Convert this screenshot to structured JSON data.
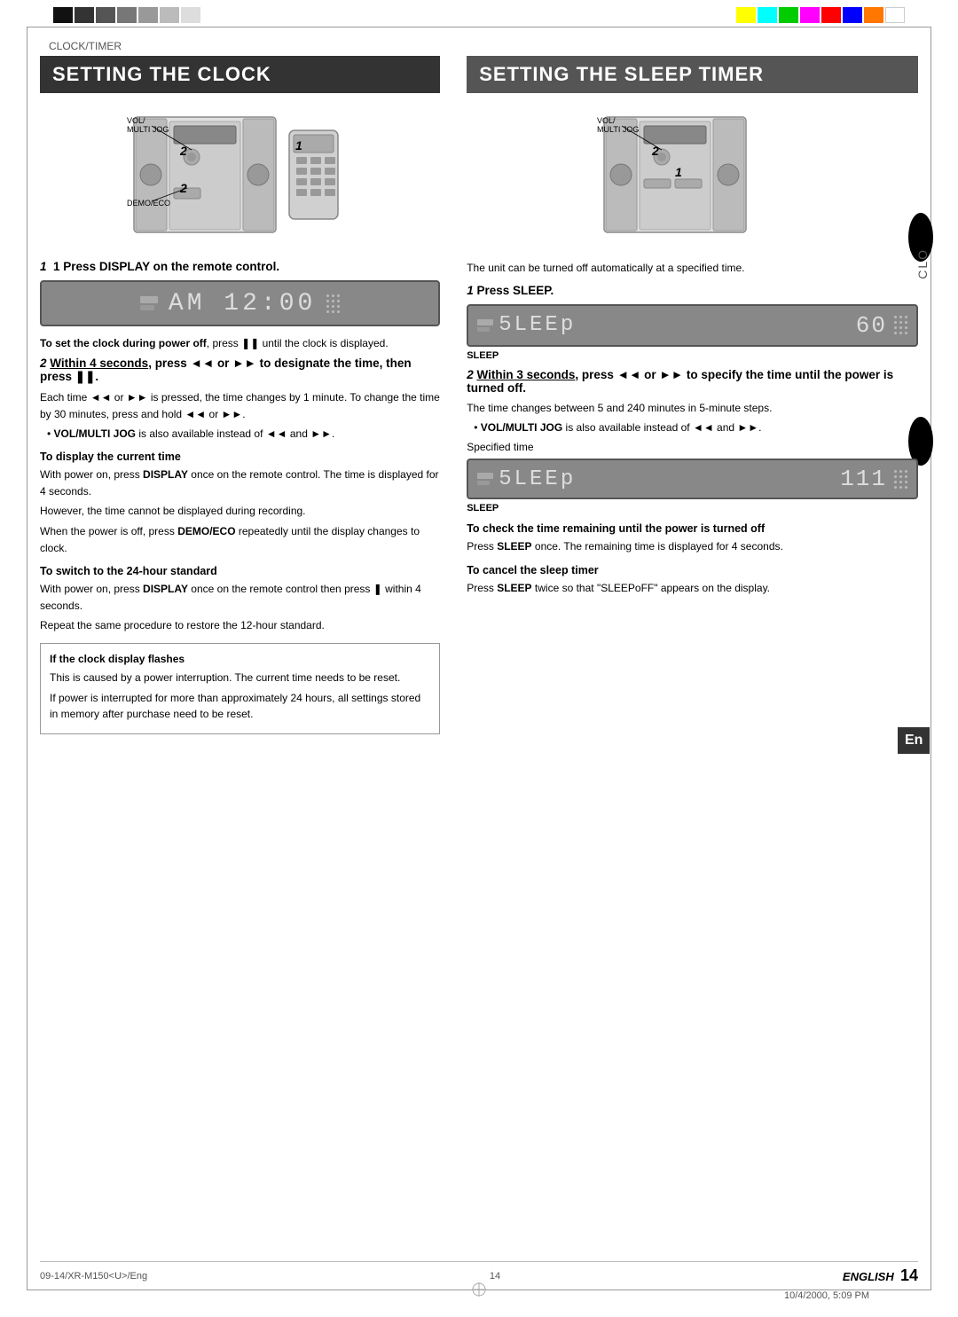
{
  "page": {
    "header_label": "CLOCK/TIMER",
    "footer_left": "09-14/XR-M150<U>/Eng",
    "footer_center": "14",
    "footer_right_label": "ENGLISH",
    "footer_page_num": "14",
    "footer_date": "10/4/2000, 5:09 PM",
    "en_badge": "En",
    "clc_side": "CLO"
  },
  "color_bars_left": [
    "#000",
    "#333",
    "#555",
    "#777",
    "#999",
    "#bbb",
    "#ddd"
  ],
  "color_bars_right": [
    "#ffff00",
    "#00ffff",
    "#00ff00",
    "#ff00ff",
    "#ff0000",
    "#0000ff",
    "#ff7700",
    "#ffffff"
  ],
  "left_section": {
    "title": "SETTING THE CLOCK",
    "step1_heading": "1  Press DISPLAY on the remote control.",
    "display_text": "AM 12:00",
    "note1_bold": "To set the clock during power off",
    "note1_text": ", press ❚❚ until the clock is displayed.",
    "step2_heading": "2  Within 4 seconds, press ◄◄ or ►► to designate the time, then press ❚❚.",
    "within_underline": "Within 4 seconds",
    "step2_body1": "Each time ◄◄ or ►► is pressed, the time changes by 1 minute. To change the time by 30 minutes, press and hold ◄◄ or ►►.",
    "bullet1": "VOL/MULTI JOG is also available instead of ◄◄ and ►►.",
    "subsec1_title": "To display the current time",
    "subsec1_body1": "With power on, press DISPLAY once on the remote control. The time is displayed for 4 seconds.",
    "subsec1_body2": "However, the time cannot be displayed during recording.",
    "subsec1_body3": "When the power is off, press DEMO/ECO repeatedly until the display changes to clock.",
    "subsec2_title": "To switch to the 24-hour standard",
    "subsec2_body1": "With power on, press DISPLAY once on the remote control then press ❚ within 4 seconds.",
    "subsec2_body2": "Repeat the same procedure to restore the 12-hour standard.",
    "infobox_title": "If the clock display flashes",
    "infobox_body1": "This is caused by a power interruption. The current time needs to be reset.",
    "infobox_body2": "If power is interrupted for more than approximately 24 hours, all settings stored in memory after purchase need to be reset.",
    "device_labels": {
      "vol_multi_jog": "VOL/\nMULTI JOG",
      "demo_eco": "DEMO/ECO",
      "num2a": "2",
      "num1": "1",
      "num2b": "2"
    }
  },
  "right_section": {
    "title": "SETTING THE SLEEP TIMER",
    "intro_text": "The unit can be turned off automatically at a specified time.",
    "step1_heading": "1  Press SLEEP.",
    "sleep_display_text": "5LEEp",
    "sleep_display_num": "60",
    "sleep_label": "SLEEP",
    "step2_heading": "2  Within 3 seconds, press ◄◄ or ►► to specify the time until the power is turned off.",
    "within_underline": "Within 3 seconds",
    "step2_body1": "The time changes between 5 and 240 minutes in 5-minute steps.",
    "bullet1": "VOL/MULTI JOG is also available instead of ◄◄ and ►►.",
    "specified_time_label": "Specified time",
    "sleep_display2_text": "5LEEp",
    "sleep_display2_num": "111",
    "sleep_label2": "SLEEP",
    "subsec1_title": "To check the time remaining until the power is turned off",
    "subsec1_body1": "Press SLEEP once. The remaining time is displayed for 4 seconds.",
    "subsec2_title": "To cancel the sleep timer",
    "subsec2_body1": "Press SLEEP twice so that \"SLEEPoFF\" appears on the display.",
    "device_labels": {
      "vol_multi_jog": "VOL/\nMULTI JOG",
      "num2": "2",
      "num1": "1"
    }
  }
}
